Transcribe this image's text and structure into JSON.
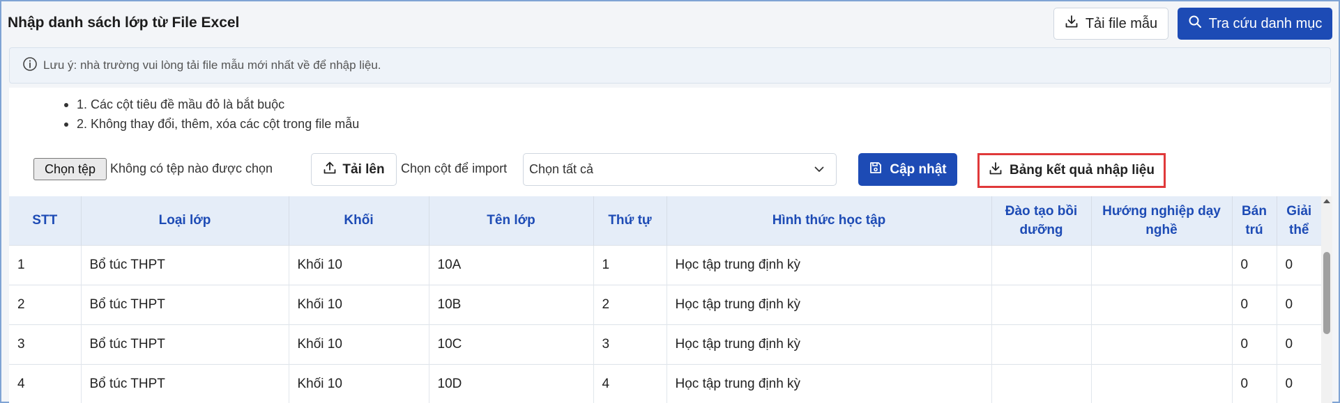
{
  "header": {
    "title": "Nhập danh sách lớp từ File Excel",
    "download_template_label": "Tải file mẫu",
    "lookup_label": "Tra cứu danh mục"
  },
  "note": {
    "text": "Lưu ý: nhà trường vui lòng tải file mẫu mới nhất về để nhập liệu."
  },
  "rules": [
    "1. Các cột tiêu đề mầu đỏ là bắt buộc",
    "2. Không thay đổi, thêm, xóa các cột trong file mẫu"
  ],
  "toolbar": {
    "choose_file_label": "Chọn tệp",
    "file_status": "Không có tệp nào được chọn",
    "upload_label": "Tải lên",
    "column_label": "Chọn cột để import",
    "column_select_value": "Chọn tất cả",
    "update_label": "Cập nhật",
    "results_label": "Bảng kết quả nhập liệu"
  },
  "table": {
    "headers": [
      "STT",
      "Loại lớp",
      "Khối",
      "Tên lớp",
      "Thứ tự",
      "Hình thức học tập",
      "Đào tạo bồi dưỡng",
      "Hướng nghiệp dạy nghề",
      "Bán trú",
      "Giải thể"
    ],
    "rows": [
      [
        "1",
        "Bổ túc THPT",
        "Khối 10",
        "10A",
        "1",
        "Học tập trung định kỳ",
        "",
        "",
        "0",
        "0"
      ],
      [
        "2",
        "Bổ túc THPT",
        "Khối 10",
        "10B",
        "2",
        "Học tập trung định kỳ",
        "",
        "",
        "0",
        "0"
      ],
      [
        "3",
        "Bổ túc THPT",
        "Khối 10",
        "10C",
        "3",
        "Học tập trung định kỳ",
        "",
        "",
        "0",
        "0"
      ],
      [
        "4",
        "Bổ túc THPT",
        "Khối 10",
        "10D",
        "4",
        "Học tập trung định kỳ",
        "",
        "",
        "0",
        "0"
      ]
    ]
  },
  "colors": {
    "primary": "#1d4bb5",
    "highlight_border": "#e0393a",
    "header_bg": "#e5edf8"
  }
}
